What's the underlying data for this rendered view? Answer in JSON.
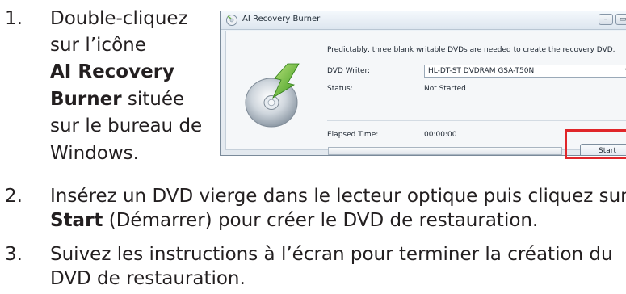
{
  "steps": [
    {
      "number": "1.",
      "lines": [
        "Double-cliquez",
        "sur l’icône",
        "AI Recovery",
        "Burner située",
        "sur le bureau de",
        "Windows."
      ],
      "bold": "AI Recovery Burner"
    },
    {
      "number": "2.",
      "text_a": "Insérez un DVD vierge dans le lecteur optique puis cliquez sur",
      "bold": "Start",
      "text_b": " (Démarrer) pour créer le DVD de restauration."
    },
    {
      "number": "3.",
      "text_a": "Suivez les instructions à l’écran pour terminer la création du",
      "text_b": "DVD de restauration."
    }
  ],
  "dialog": {
    "title": "AI Recovery Burner",
    "message": "Predictably, three blank writable DVDs are needed to create the recovery DVD.",
    "writer_label": "DVD Writer:",
    "writer_value": "HL-DT-ST DVDRAM GSA-T50N",
    "status_label": "Status:",
    "status_value": "Not Started",
    "elapsed_label": "Elapsed Time:",
    "elapsed_value": "00:00:00",
    "progress": 0,
    "start_label": "Start",
    "minimize_icon": "minimize-icon",
    "maximize_icon": "maximize-icon",
    "highlight_color": "#e0262a"
  }
}
